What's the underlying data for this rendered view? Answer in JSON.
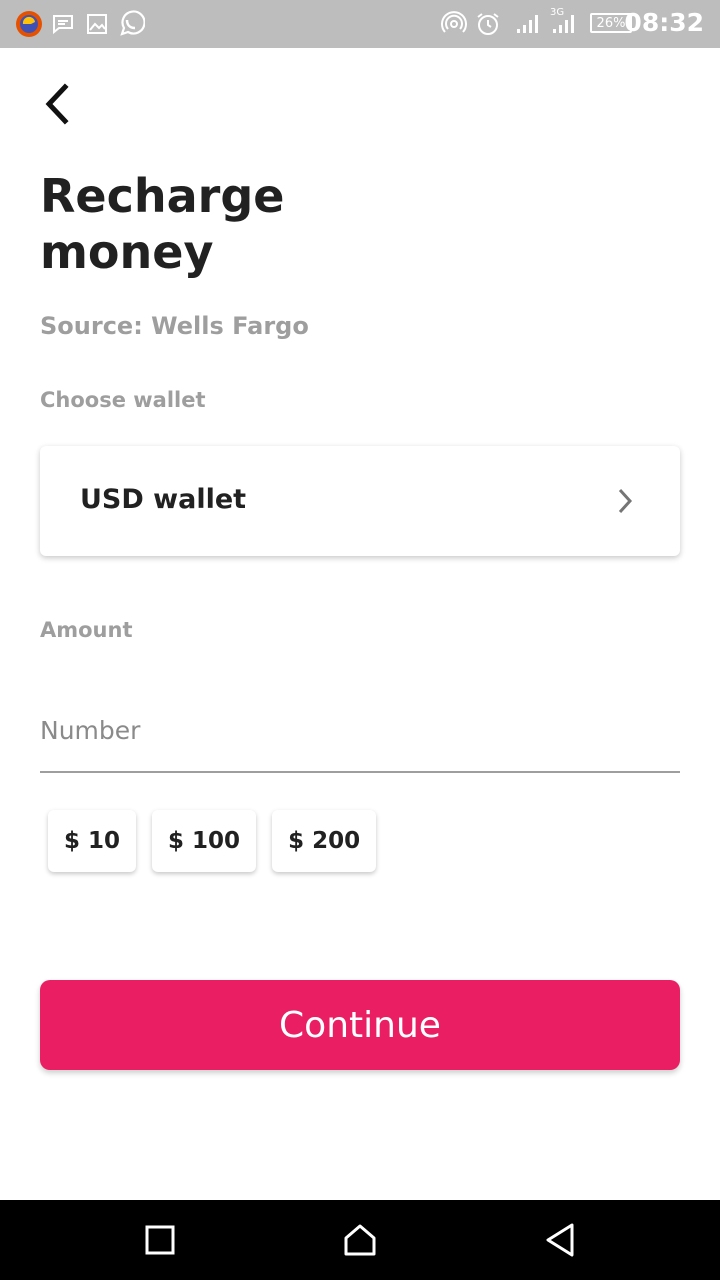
{
  "status_bar": {
    "time": "08:32",
    "battery": "26%",
    "network": "3G",
    "left_icons": [
      "browser-icon",
      "message-icon",
      "gallery-icon",
      "whatsapp-icon"
    ],
    "right_icons": [
      "hotspot-icon",
      "alarm-icon",
      "signal-icon",
      "signal-3g-icon",
      "battery-icon"
    ]
  },
  "header": {
    "back_icon": "chevron-left-icon",
    "title": "Recharge money"
  },
  "source": "Source: Wells Fargo",
  "wallet": {
    "label": "Choose wallet",
    "selected": "USD wallet",
    "chevron_icon": "chevron-right-icon"
  },
  "amount": {
    "label": "Amount",
    "placeholder": "Number",
    "value": "",
    "quick_options": [
      "$ 10",
      "$ 100",
      "$ 200"
    ]
  },
  "continue_label": "Continue",
  "colors": {
    "accent": "#e91e63",
    "status_bar": "#bdbdbd",
    "muted_text": "#9e9e9e"
  },
  "nav_bar": {
    "icons": [
      "recents-square-icon",
      "home-icon",
      "back-triangle-icon"
    ]
  }
}
